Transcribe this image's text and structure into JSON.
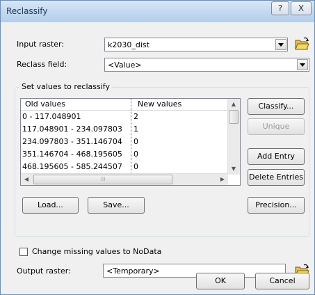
{
  "window": {
    "title": "Reclassify",
    "help_button": "?",
    "close_button": "X"
  },
  "input_raster": {
    "label": "Input raster:",
    "value": "k2030_dist"
  },
  "reclass_field": {
    "label": "Reclass field:",
    "value": "<Value>"
  },
  "set_values_group": {
    "legend": "Set values to reclassify",
    "columns": [
      "Old values",
      "New values"
    ],
    "rows": [
      {
        "old": "0 - 117.048901",
        "new": "2"
      },
      {
        "old": "117.048901 - 234.097803",
        "new": "1"
      },
      {
        "old": "234.097803 - 351.146704",
        "new": "0"
      },
      {
        "old": "351.146704 - 468.195605",
        "new": "0"
      },
      {
        "old": "468.195605 - 585.244507",
        "new": "0"
      }
    ],
    "buttons": {
      "classify": "Classify...",
      "unique": "Unique",
      "add_entry": "Add Entry",
      "delete_entries": "Delete Entries",
      "load": "Load...",
      "save": "Save...",
      "precision": "Precision..."
    }
  },
  "missing_values": {
    "label": "Change missing values to NoData",
    "checked": false
  },
  "output_raster": {
    "label": "Output raster:",
    "value": "<Temporary>"
  },
  "footer": {
    "ok": "OK",
    "cancel": "Cancel"
  },
  "icons": [
    "folder-open-icon",
    "dropdown-arrow-icon",
    "scroll-up-arrow-icon",
    "scroll-down-arrow-icon",
    "scroll-left-arrow-icon",
    "scroll-right-arrow-icon"
  ]
}
